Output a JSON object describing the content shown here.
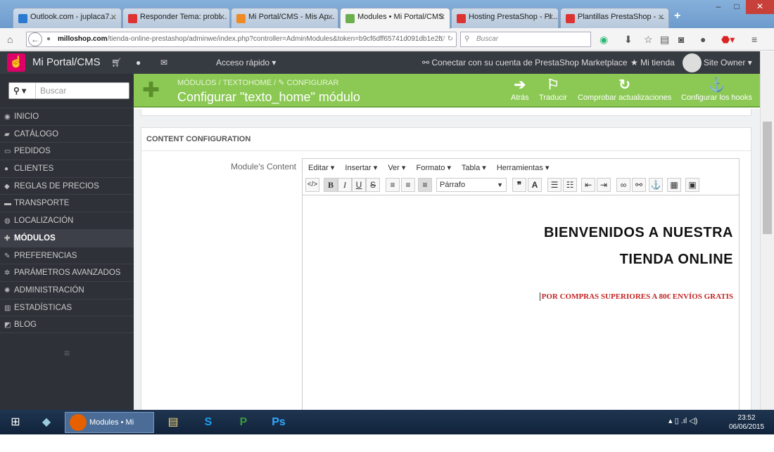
{
  "browser": {
    "tabs": [
      {
        "label": "Outlook.com - juplaca7...",
        "color": "#2a7ad2"
      },
      {
        "label": "Responder Tema: probl...",
        "color": "#d33"
      },
      {
        "label": "Mi Portal/CMS - Mis Ap...",
        "color": "#f08a24"
      },
      {
        "label": "Modules • Mi Portal/CMS",
        "color": "#6ab04c"
      },
      {
        "label": "Hosting PrestaShop - Pl...",
        "color": "#d33"
      },
      {
        "label": "Plantillas PrestaShop - ...",
        "color": "#d33"
      }
    ],
    "url_host": "milloshop.com",
    "url_path": "/tienda-online-prestashop/adminwe/index.php?controller=AdminModules&token=b9cf6dff65741d091db1e2b",
    "search_placeholder": "Buscar"
  },
  "header": {
    "brand": "Mi Portal/CMS",
    "quick_access": "Acceso rápido ▾",
    "marketplace": "Conectar con su cuenta de PrestaShop Marketplace",
    "my_store": "Mi tienda",
    "owner": "Site Owner ▾"
  },
  "sidebar": {
    "search_placeholder": "Buscar",
    "items": [
      {
        "label": "INICIO",
        "icon": "dashboard-icon"
      },
      {
        "label": "CATÁLOGO",
        "icon": "book-icon"
      },
      {
        "label": "PEDIDOS",
        "icon": "card-icon"
      },
      {
        "label": "CLIENTES",
        "icon": "users-icon"
      },
      {
        "label": "REGLAS DE PRECIOS",
        "icon": "tag-icon"
      },
      {
        "label": "TRANSPORTE",
        "icon": "truck-icon"
      },
      {
        "label": "LOCALIZACIÓN",
        "icon": "globe-icon"
      },
      {
        "label": "MÓDULOS",
        "icon": "puzzle-icon"
      },
      {
        "label": "PREFERENCIAS",
        "icon": "wrench-icon"
      },
      {
        "label": "PARÁMETROS AVANZADOS",
        "icon": "cogs-icon"
      },
      {
        "label": "ADMINISTRACIÓN",
        "icon": "cog-icon"
      },
      {
        "label": "ESTADÍSTICAS",
        "icon": "chart-icon"
      },
      {
        "label": "BLOG",
        "icon": "edit-icon"
      }
    ]
  },
  "toolbar": {
    "breadcrumb": "MÓDULOS  /  TEXTOHOME  /  ✎ CONFIGURAR",
    "title": "Configurar \"texto_home\" módulo",
    "back": "Atrás",
    "translate": "Traducir",
    "check_updates": "Comprobar actualizaciones",
    "hooks": "Configurar los hooks"
  },
  "panel": {
    "heading": "CONTENT CONFIGURATION",
    "field_label": "Module's Content",
    "editor_menu": [
      "Editar ▾",
      "Insertar ▾",
      "Ver ▾",
      "Formato ▾",
      "Tabla ▾",
      "Herramientas ▾"
    ],
    "format_value": "Párrafo",
    "content_line1": "BIENVENIDOS A NUESTRA",
    "content_line2": "TIENDA ONLINE",
    "content_promo": "POR COMPRAS SUPERIORES A 80€ ENVÍOS GRATIS"
  },
  "taskbar": {
    "firefox_label": "Modules • Mi Por...",
    "time": "23:52",
    "date": "06/06/2015"
  },
  "colors": {
    "toolbar_green": "#8bc954",
    "header_dark": "#363a41",
    "sidebar_dark": "#2e3138",
    "promo_red": "#c42525"
  }
}
